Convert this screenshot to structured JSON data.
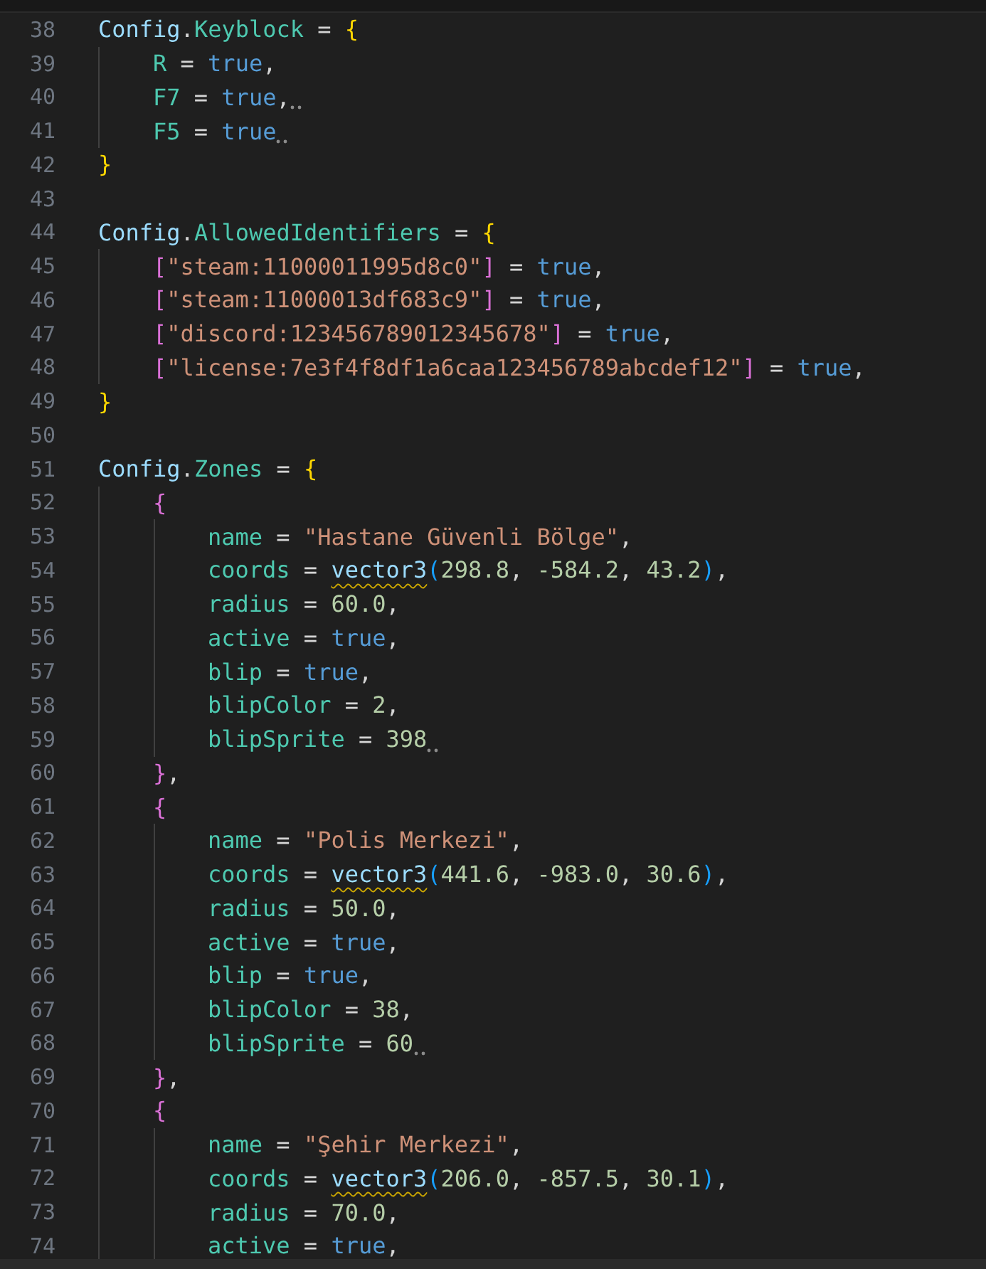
{
  "editor": {
    "lines": [
      {
        "number": "38",
        "hint": false,
        "tokens": [
          {
            "kind": "variable",
            "text": "Config"
          },
          {
            "kind": "punct",
            "text": "."
          },
          {
            "kind": "property",
            "text": "Keyblock"
          },
          {
            "kind": "punct",
            "text": " = "
          },
          {
            "kind": "bracket",
            "color": "#ffd700",
            "text": "{"
          }
        ],
        "children": [
          {
            "number": "39",
            "hint": false,
            "tokens": [
              {
                "kind": "property",
                "text": "R"
              },
              {
                "kind": "punct",
                "text": " = "
              },
              {
                "kind": "keyword",
                "text": "true"
              },
              {
                "kind": "punct",
                "text": ","
              }
            ]
          },
          {
            "number": "40",
            "hint": true,
            "tokens": [
              {
                "kind": "property",
                "text": "F7"
              },
              {
                "kind": "punct",
                "text": " = "
              },
              {
                "kind": "keyword",
                "text": "true"
              },
              {
                "kind": "punct",
                "text": ","
              }
            ]
          },
          {
            "number": "41",
            "hint": true,
            "tokens": [
              {
                "kind": "property",
                "text": "F5"
              },
              {
                "kind": "punct",
                "text": " = "
              },
              {
                "kind": "keyword",
                "text": "true"
              }
            ]
          }
        ]
      },
      {
        "number": "42",
        "hint": false,
        "tokens": [
          {
            "kind": "bracket",
            "color": "#ffd700",
            "text": "}"
          }
        ]
      },
      {
        "number": "43",
        "hint": false
      },
      {
        "number": "44",
        "hint": false,
        "tokens": [
          {
            "kind": "variable",
            "text": "Config"
          },
          {
            "kind": "punct",
            "text": "."
          },
          {
            "kind": "property",
            "text": "AllowedIdentifiers"
          },
          {
            "kind": "punct",
            "text": " = "
          },
          {
            "kind": "bracket",
            "color": "#ffd700",
            "text": "{"
          }
        ],
        "children": [
          {
            "number": "45",
            "hint": false,
            "tokens": [
              {
                "kind": "bracket",
                "color": "#da70d6",
                "text": "["
              },
              {
                "kind": "string",
                "text": "\"steam:11000011995d8c0\""
              },
              {
                "kind": "bracket",
                "color": "#da70d6",
                "text": "]"
              },
              {
                "kind": "punct",
                "text": " = "
              },
              {
                "kind": "keyword",
                "text": "true"
              },
              {
                "kind": "punct",
                "text": ","
              }
            ]
          },
          {
            "number": "46",
            "hint": false,
            "tokens": [
              {
                "kind": "bracket",
                "color": "#da70d6",
                "text": "["
              },
              {
                "kind": "string",
                "text": "\"steam:11000013df683c9\""
              },
              {
                "kind": "bracket",
                "color": "#da70d6",
                "text": "]"
              },
              {
                "kind": "punct",
                "text": " = "
              },
              {
                "kind": "keyword",
                "text": "true"
              },
              {
                "kind": "punct",
                "text": ","
              }
            ]
          },
          {
            "number": "47",
            "hint": false,
            "tokens": [
              {
                "kind": "bracket",
                "color": "#da70d6",
                "text": "["
              },
              {
                "kind": "string",
                "text": "\"discord:123456789012345678\""
              },
              {
                "kind": "bracket",
                "color": "#da70d6",
                "text": "]"
              },
              {
                "kind": "punct",
                "text": " = "
              },
              {
                "kind": "keyword",
                "text": "true"
              },
              {
                "kind": "punct",
                "text": ","
              }
            ]
          },
          {
            "number": "48",
            "hint": false,
            "tokens": [
              {
                "kind": "bracket",
                "color": "#da70d6",
                "text": "["
              },
              {
                "kind": "string",
                "text": "\"license:7e3f4f8df1a6caa123456789abcdef12\""
              },
              {
                "kind": "bracket",
                "color": "#da70d6",
                "text": "]"
              },
              {
                "kind": "punct",
                "text": " = "
              },
              {
                "kind": "keyword",
                "text": "true"
              },
              {
                "kind": "punct",
                "text": ","
              }
            ]
          }
        ]
      },
      {
        "number": "49",
        "hint": false,
        "tokens": [
          {
            "kind": "bracket",
            "color": "#ffd700",
            "text": "}"
          }
        ]
      },
      {
        "number": "50",
        "hint": false
      },
      {
        "number": "51",
        "hint": false,
        "tokens": [
          {
            "kind": "variable",
            "text": "Config"
          },
          {
            "kind": "punct",
            "text": "."
          },
          {
            "kind": "property",
            "text": "Zones"
          },
          {
            "kind": "punct",
            "text": " = "
          },
          {
            "kind": "bracket",
            "color": "#ffd700",
            "text": "{"
          }
        ],
        "children": [
          {
            "number": "52",
            "hint": false,
            "tokens": [
              {
                "kind": "bracket",
                "color": "#da70d6",
                "text": "{"
              }
            ],
            "children": [
              {
                "number": "53",
                "hint": false,
                "tokens": [
                  {
                    "kind": "property",
                    "text": "name"
                  },
                  {
                    "kind": "punct",
                    "text": " = "
                  },
                  {
                    "kind": "string",
                    "text": "\"Hastane Güvenli Bölge\""
                  },
                  {
                    "kind": "punct",
                    "text": ","
                  }
                ]
              },
              {
                "number": "54",
                "hint": false,
                "tokens": [
                  {
                    "kind": "property",
                    "text": "coords"
                  },
                  {
                    "kind": "punct",
                    "text": " = "
                  },
                  {
                    "kind": "function",
                    "warning": true,
                    "text": "vector3"
                  },
                  {
                    "kind": "bracket",
                    "color": "#179fff",
                    "text": "("
                  },
                  {
                    "kind": "number",
                    "text": "298.8"
                  },
                  {
                    "kind": "punct",
                    "text": ", "
                  },
                  {
                    "kind": "number",
                    "text": "-584.2"
                  },
                  {
                    "kind": "punct",
                    "text": ", "
                  },
                  {
                    "kind": "number",
                    "text": "43.2"
                  },
                  {
                    "kind": "bracket",
                    "color": "#179fff",
                    "text": ")"
                  },
                  {
                    "kind": "punct",
                    "text": ","
                  }
                ]
              },
              {
                "number": "55",
                "hint": false,
                "tokens": [
                  {
                    "kind": "property",
                    "text": "radius"
                  },
                  {
                    "kind": "punct",
                    "text": " = "
                  },
                  {
                    "kind": "number",
                    "text": "60.0"
                  },
                  {
                    "kind": "punct",
                    "text": ","
                  }
                ]
              },
              {
                "number": "56",
                "hint": false,
                "tokens": [
                  {
                    "kind": "property",
                    "text": "active"
                  },
                  {
                    "kind": "punct",
                    "text": " = "
                  },
                  {
                    "kind": "keyword",
                    "text": "true"
                  },
                  {
                    "kind": "punct",
                    "text": ","
                  }
                ]
              },
              {
                "number": "57",
                "hint": false,
                "tokens": [
                  {
                    "kind": "property",
                    "text": "blip"
                  },
                  {
                    "kind": "punct",
                    "text": " = "
                  },
                  {
                    "kind": "keyword",
                    "text": "true"
                  },
                  {
                    "kind": "punct",
                    "text": ","
                  }
                ]
              },
              {
                "number": "58",
                "hint": false,
                "tokens": [
                  {
                    "kind": "property",
                    "text": "blipColor"
                  },
                  {
                    "kind": "punct",
                    "text": " = "
                  },
                  {
                    "kind": "number",
                    "text": "2"
                  },
                  {
                    "kind": "punct",
                    "text": ","
                  }
                ]
              },
              {
                "number": "59",
                "hint": true,
                "tokens": [
                  {
                    "kind": "property",
                    "text": "blipSprite"
                  },
                  {
                    "kind": "punct",
                    "text": " = "
                  },
                  {
                    "kind": "number",
                    "text": "398"
                  }
                ]
              }
            ]
          },
          {
            "number": "60",
            "hint": false,
            "tokens": [
              {
                "kind": "bracket",
                "color": "#da70d6",
                "text": "}"
              },
              {
                "kind": "punct",
                "text": ","
              }
            ]
          },
          {
            "number": "61",
            "hint": false,
            "tokens": [
              {
                "kind": "bracket",
                "color": "#da70d6",
                "text": "{"
              }
            ],
            "children": [
              {
                "number": "62",
                "hint": false,
                "tokens": [
                  {
                    "kind": "property",
                    "text": "name"
                  },
                  {
                    "kind": "punct",
                    "text": " = "
                  },
                  {
                    "kind": "string",
                    "text": "\"Polis Merkezi\""
                  },
                  {
                    "kind": "punct",
                    "text": ","
                  }
                ]
              },
              {
                "number": "63",
                "hint": false,
                "tokens": [
                  {
                    "kind": "property",
                    "text": "coords"
                  },
                  {
                    "kind": "punct",
                    "text": " = "
                  },
                  {
                    "kind": "function",
                    "warning": true,
                    "text": "vector3"
                  },
                  {
                    "kind": "bracket",
                    "color": "#179fff",
                    "text": "("
                  },
                  {
                    "kind": "number",
                    "text": "441.6"
                  },
                  {
                    "kind": "punct",
                    "text": ", "
                  },
                  {
                    "kind": "number",
                    "text": "-983.0"
                  },
                  {
                    "kind": "punct",
                    "text": ", "
                  },
                  {
                    "kind": "number",
                    "text": "30.6"
                  },
                  {
                    "kind": "bracket",
                    "color": "#179fff",
                    "text": ")"
                  },
                  {
                    "kind": "punct",
                    "text": ","
                  }
                ]
              },
              {
                "number": "64",
                "hint": false,
                "tokens": [
                  {
                    "kind": "property",
                    "text": "radius"
                  },
                  {
                    "kind": "punct",
                    "text": " = "
                  },
                  {
                    "kind": "number",
                    "text": "50.0"
                  },
                  {
                    "kind": "punct",
                    "text": ","
                  }
                ]
              },
              {
                "number": "65",
                "hint": false,
                "tokens": [
                  {
                    "kind": "property",
                    "text": "active"
                  },
                  {
                    "kind": "punct",
                    "text": " = "
                  },
                  {
                    "kind": "keyword",
                    "text": "true"
                  },
                  {
                    "kind": "punct",
                    "text": ","
                  }
                ]
              },
              {
                "number": "66",
                "hint": false,
                "tokens": [
                  {
                    "kind": "property",
                    "text": "blip"
                  },
                  {
                    "kind": "punct",
                    "text": " = "
                  },
                  {
                    "kind": "keyword",
                    "text": "true"
                  },
                  {
                    "kind": "punct",
                    "text": ","
                  }
                ]
              },
              {
                "number": "67",
                "hint": false,
                "tokens": [
                  {
                    "kind": "property",
                    "text": "blipColor"
                  },
                  {
                    "kind": "punct",
                    "text": " = "
                  },
                  {
                    "kind": "number",
                    "text": "38"
                  },
                  {
                    "kind": "punct",
                    "text": ","
                  }
                ]
              },
              {
                "number": "68",
                "hint": true,
                "tokens": [
                  {
                    "kind": "property",
                    "text": "blipSprite"
                  },
                  {
                    "kind": "punct",
                    "text": " = "
                  },
                  {
                    "kind": "number",
                    "text": "60"
                  }
                ]
              }
            ]
          },
          {
            "number": "69",
            "hint": false,
            "tokens": [
              {
                "kind": "bracket",
                "color": "#da70d6",
                "text": "}"
              },
              {
                "kind": "punct",
                "text": ","
              }
            ]
          },
          {
            "number": "70",
            "hint": false,
            "tokens": [
              {
                "kind": "bracket",
                "color": "#da70d6",
                "text": "{"
              }
            ],
            "children": [
              {
                "number": "71",
                "hint": false,
                "tokens": [
                  {
                    "kind": "property",
                    "text": "name"
                  },
                  {
                    "kind": "punct",
                    "text": " = "
                  },
                  {
                    "kind": "string",
                    "text": "\"Şehir Merkezi\""
                  },
                  {
                    "kind": "punct",
                    "text": ","
                  }
                ]
              },
              {
                "number": "72",
                "hint": false,
                "tokens": [
                  {
                    "kind": "property",
                    "text": "coords"
                  },
                  {
                    "kind": "punct",
                    "text": " = "
                  },
                  {
                    "kind": "function",
                    "warning": true,
                    "text": "vector3"
                  },
                  {
                    "kind": "bracket",
                    "color": "#179fff",
                    "text": "("
                  },
                  {
                    "kind": "number",
                    "text": "206.0"
                  },
                  {
                    "kind": "punct",
                    "text": ", "
                  },
                  {
                    "kind": "number",
                    "text": "-857.5"
                  },
                  {
                    "kind": "punct",
                    "text": ", "
                  },
                  {
                    "kind": "number",
                    "text": "30.1"
                  },
                  {
                    "kind": "bracket",
                    "color": "#179fff",
                    "text": ")"
                  },
                  {
                    "kind": "punct",
                    "text": ","
                  }
                ]
              },
              {
                "number": "73",
                "hint": false,
                "tokens": [
                  {
                    "kind": "property",
                    "text": "radius"
                  },
                  {
                    "kind": "punct",
                    "text": " = "
                  },
                  {
                    "kind": "number",
                    "text": "70.0"
                  },
                  {
                    "kind": "punct",
                    "text": ","
                  }
                ]
              },
              {
                "number": "74",
                "hint": false,
                "tokens": [
                  {
                    "kind": "property",
                    "text": "active"
                  },
                  {
                    "kind": "punct",
                    "text": " = "
                  },
                  {
                    "kind": "keyword",
                    "text": "true"
                  },
                  {
                    "kind": "punct",
                    "text": ","
                  }
                ]
              }
            ]
          }
        ]
      }
    ]
  }
}
